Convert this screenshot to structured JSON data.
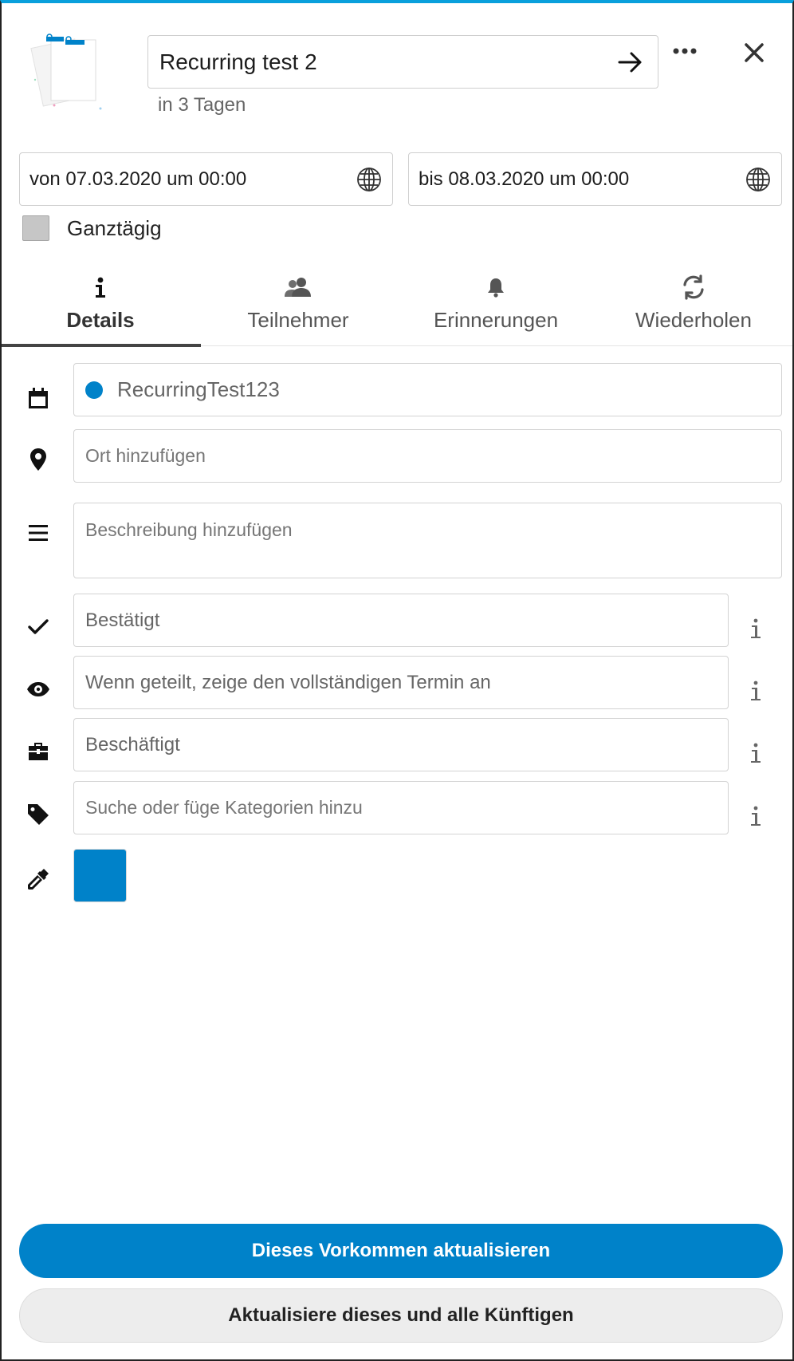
{
  "header": {
    "title": "Recurring test 2",
    "subtitle": "in 3 Tagen",
    "icons": {
      "document": "document-stack-icon",
      "save_arrow": "arrow-right-icon",
      "more": "more-dots-icon",
      "close": "close-icon"
    }
  },
  "dates": {
    "from": "von 07.03.2020 um 00:00",
    "to": "bis 08.03.2020 um 00:00",
    "timezone_icon": "globe-icon"
  },
  "allday": {
    "label": "Ganztägig",
    "checked": false
  },
  "tabs": [
    {
      "label": "Details",
      "icon": "info-icon",
      "active": true
    },
    {
      "label": "Teilnehmer",
      "icon": "people-icon",
      "active": false
    },
    {
      "label": "Erinnerungen",
      "icon": "bell-icon",
      "active": false
    },
    {
      "label": "Wiederholen",
      "icon": "refresh-icon",
      "active": false
    }
  ],
  "details": {
    "calendar": {
      "value": "RecurringTest123",
      "color": "#0082c9",
      "icon": "calendar-icon"
    },
    "location": {
      "placeholder": "Ort hinzufügen",
      "icon": "location-pin-icon"
    },
    "description": {
      "placeholder": "Beschreibung hinzufügen",
      "icon": "menu-lines-icon"
    },
    "status": {
      "value": "Bestätigt",
      "icon": "check-icon"
    },
    "visibility": {
      "value": "Wenn geteilt, zeige den vollständigen Termin an",
      "icon": "eye-icon"
    },
    "availability": {
      "value": "Beschäftigt",
      "icon": "briefcase-icon"
    },
    "categories": {
      "placeholder": "Suche oder füge Kategorien hinzu",
      "icon": "tag-icon"
    },
    "color": {
      "value": "#0082c9",
      "icon": "eyedropper-icon"
    }
  },
  "actions": {
    "primary": "Dieses Vorkommen aktualisieren",
    "secondary": "Aktualisiere dieses und alle Künftigen"
  },
  "colors": {
    "accent": "#0082c9",
    "top_bar": "#0aa0dc"
  }
}
